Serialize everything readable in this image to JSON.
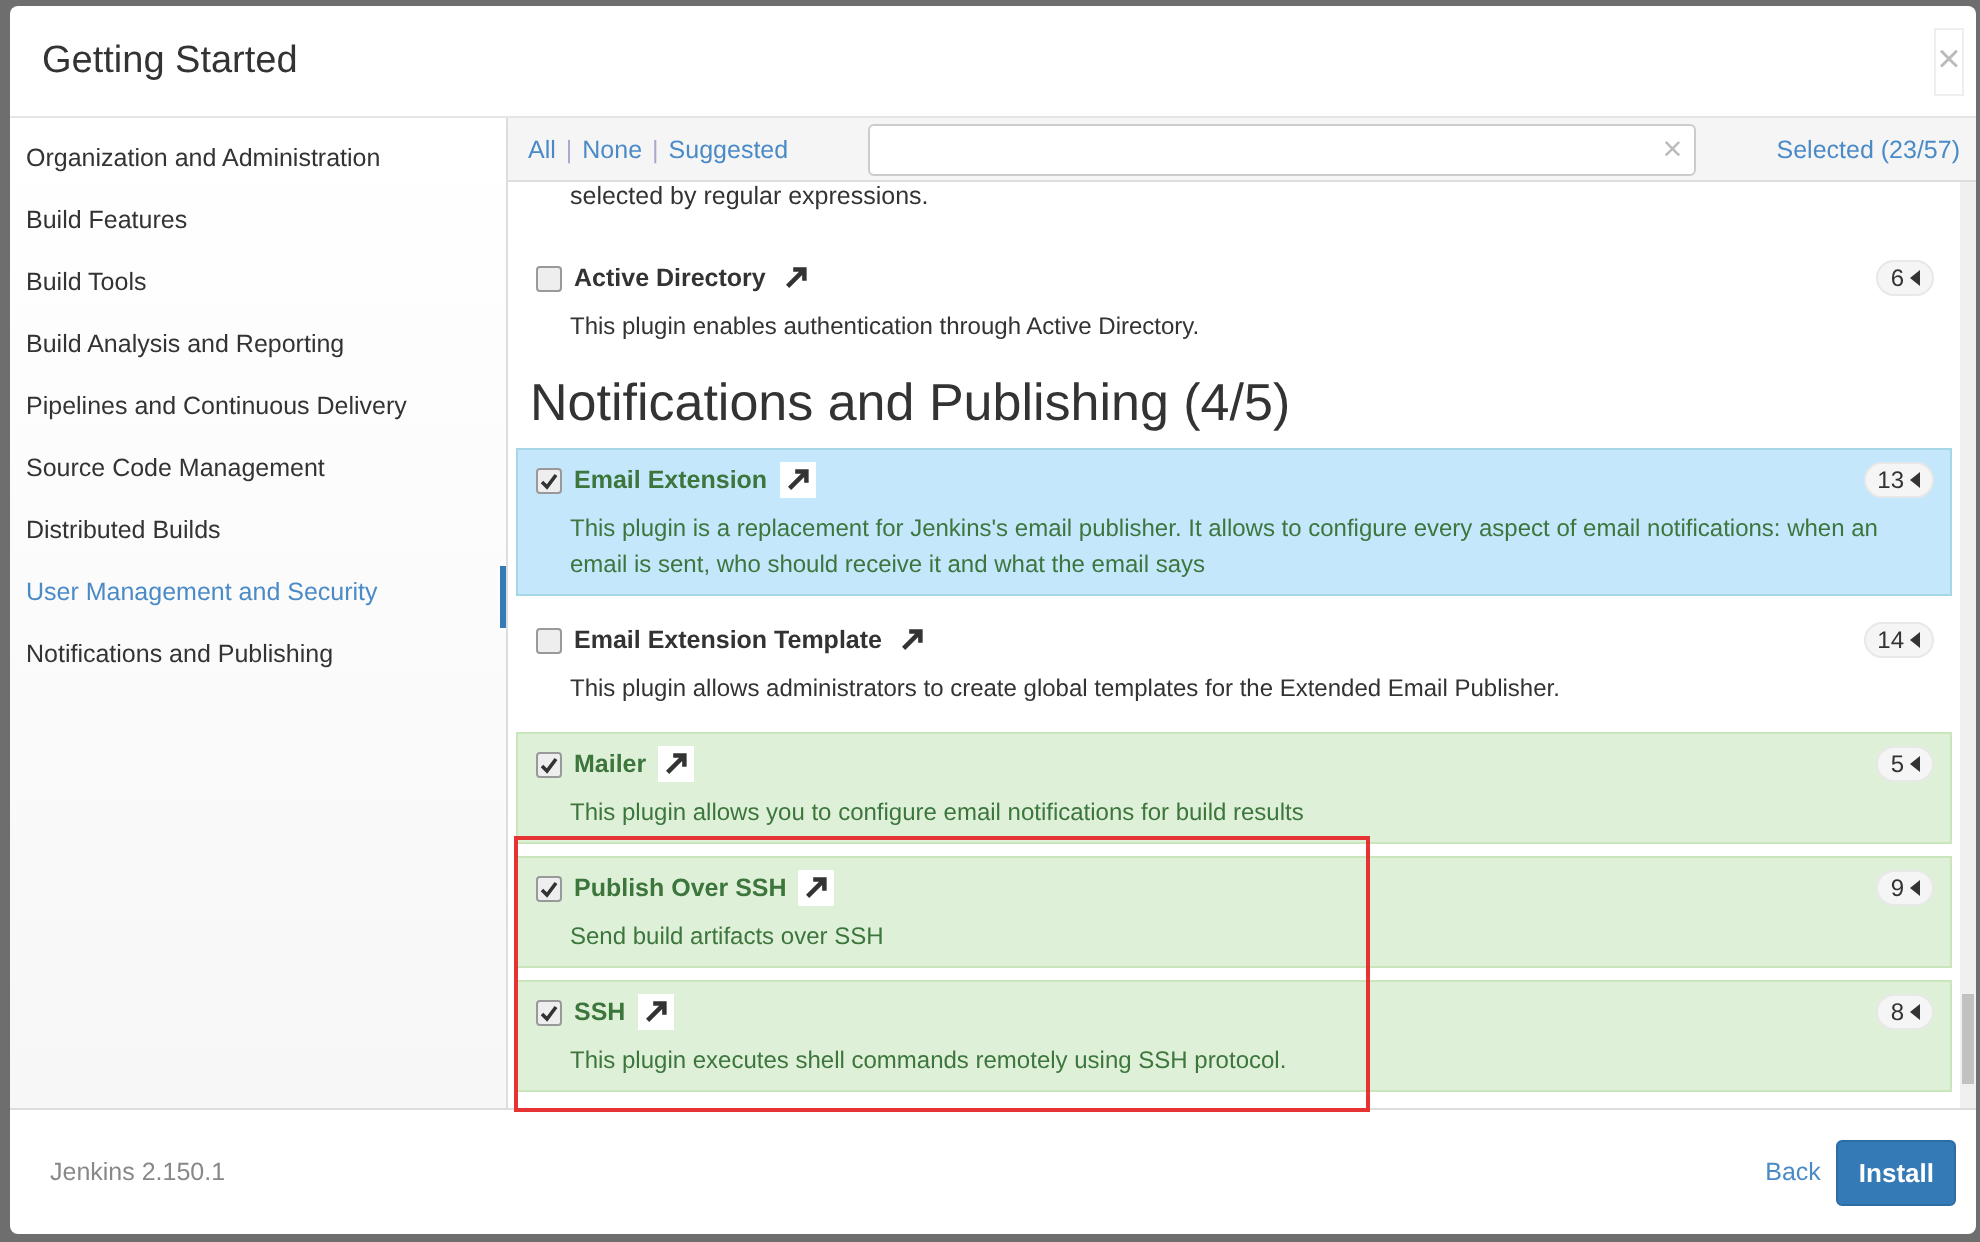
{
  "dialog": {
    "title": "Getting Started",
    "close": "×"
  },
  "sidebar": {
    "items": [
      {
        "label": "Organization and Administration",
        "selected": false
      },
      {
        "label": "Build Features",
        "selected": false
      },
      {
        "label": "Build Tools",
        "selected": false
      },
      {
        "label": "Build Analysis and Reporting",
        "selected": false
      },
      {
        "label": "Pipelines and Continuous Delivery",
        "selected": false
      },
      {
        "label": "Source Code Management",
        "selected": false
      },
      {
        "label": "Distributed Builds",
        "selected": false
      },
      {
        "label": "User Management and Security",
        "selected": true
      },
      {
        "label": "Notifications and Publishing",
        "selected": false
      }
    ]
  },
  "toolbar": {
    "filters": [
      "All",
      "None",
      "Suggested"
    ],
    "separator": "|",
    "search": {
      "clear": "×"
    },
    "selected_count": "Selected (23/57)"
  },
  "content": [
    {
      "kind": "text",
      "text": "selected by regular expressions."
    },
    {
      "kind": "plugin",
      "name": "Active Directory",
      "description": "This plugin enables authentication through Active Directory.",
      "dependencies": "6",
      "checked": false,
      "focused": false
    },
    {
      "kind": "heading",
      "text": "Notifications and Publishing (4/5)"
    },
    {
      "kind": "plugin",
      "name": "Email Extension",
      "description": "This plugin is a replacement for Jenkins's email publisher. It allows to configure every aspect of email notifications: when an email is sent, who should receive it and what the email says",
      "dependencies": "13",
      "checked": true,
      "focused": true
    },
    {
      "kind": "plugin",
      "name": "Email Extension Template",
      "description": "This plugin allows administrators to create global templates for the Extended Email Publisher.",
      "dependencies": "14",
      "checked": false,
      "focused": false
    },
    {
      "kind": "plugin",
      "name": "Mailer",
      "description": "This plugin allows you to configure email notifications for build results",
      "dependencies": "5",
      "checked": true,
      "focused": false
    },
    {
      "kind": "plugin",
      "name": "Publish Over SSH",
      "description": "Send build artifacts over SSH",
      "dependencies": "9",
      "checked": true,
      "focused": false
    },
    {
      "kind": "plugin",
      "name": "SSH",
      "description": "This plugin executes shell commands remotely using SSH protocol.",
      "dependencies": "8",
      "checked": true,
      "focused": false
    }
  ],
  "footer": {
    "version": "Jenkins 2.150.1",
    "back": "Back",
    "install": "Install"
  }
}
